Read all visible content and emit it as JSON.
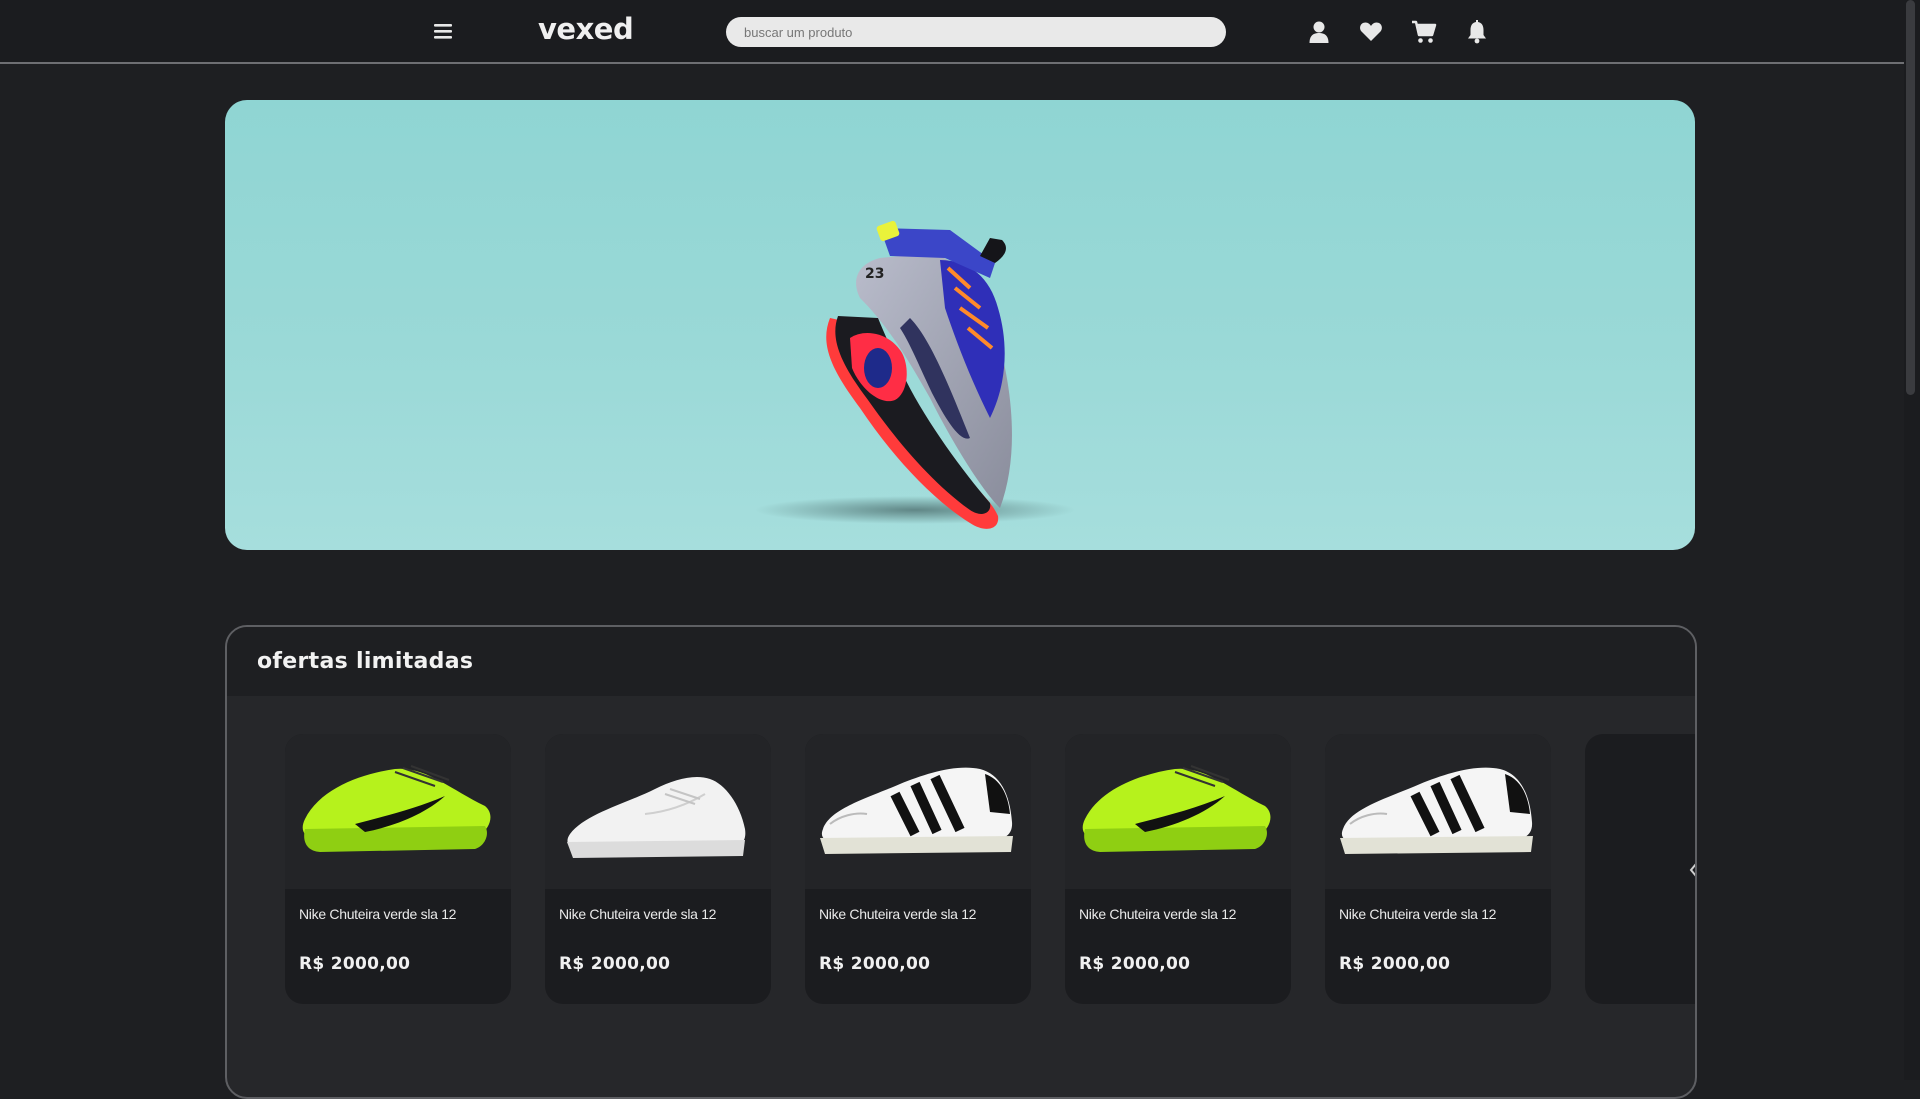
{
  "header": {
    "logo": "vexed",
    "search_placeholder": "buscar um produto",
    "icons": [
      "menu-icon",
      "user-icon",
      "heart-icon",
      "cart-icon",
      "bell-icon"
    ]
  },
  "banner": {
    "image": "floating basketball sneaker on teal background",
    "background_color": "#95d7d5"
  },
  "offers": {
    "title": "ofertas limitadas",
    "products": [
      {
        "name": "Nike Chuteira verde sla 12",
        "price": "R$  2000,00",
        "image": "neon-green-nike-sneaker"
      },
      {
        "name": "Nike Chuteira verde sla 12",
        "price": "R$  2000,00",
        "image": "white-nike-sneaker"
      },
      {
        "name": "Nike Chuteira verde sla 12",
        "price": "R$  2000,00",
        "image": "white-adidas-superstar"
      },
      {
        "name": "Nike Chuteira verde sla 12",
        "price": "R$  2000,00",
        "image": "neon-green-nike-sneaker"
      },
      {
        "name": "Nike Chuteira verde sla 12",
        "price": "R$  2000,00",
        "image": "white-adidas-superstar"
      }
    ]
  },
  "colors": {
    "page_bg": "#1e1f22",
    "card_bg": "#1b1c1f",
    "accent_green": "#b6f21c"
  }
}
